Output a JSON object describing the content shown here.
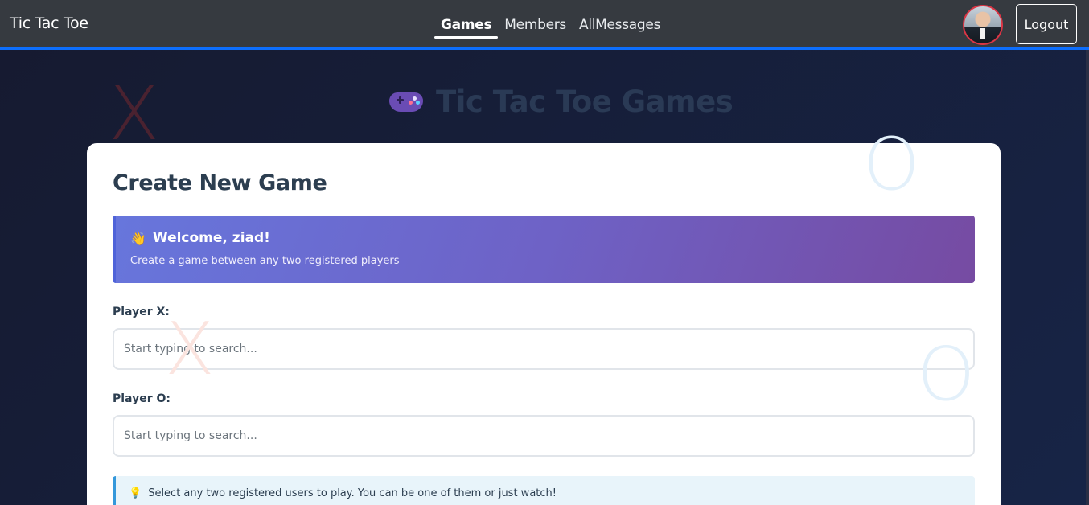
{
  "navbar": {
    "brand": "Tic Tac Toe",
    "links": [
      {
        "label": "Games",
        "active": true
      },
      {
        "label": "Members",
        "active": false
      },
      {
        "label": "AllMessages",
        "active": false
      }
    ],
    "logout_label": "Logout",
    "accent_color": "#0d6efd"
  },
  "page": {
    "title": "Tic Tac Toe Games",
    "title_icon": "gamepad-icon"
  },
  "decorations": {
    "x_mark": "X",
    "o_mark": "O"
  },
  "card": {
    "title": "Create New Game",
    "welcome": {
      "icon": "wave-icon",
      "title": "Welcome, ziad!",
      "subtitle": "Create a game between any two registered players"
    },
    "player_x": {
      "label": "Player X:",
      "placeholder": "Start typing to search...",
      "value": ""
    },
    "player_o": {
      "label": "Player O:",
      "placeholder": "Start typing to search...",
      "value": ""
    },
    "tip": {
      "icon": "lightbulb-icon",
      "text": "Select any two registered users to play. You can be one of them or just watch!"
    }
  }
}
